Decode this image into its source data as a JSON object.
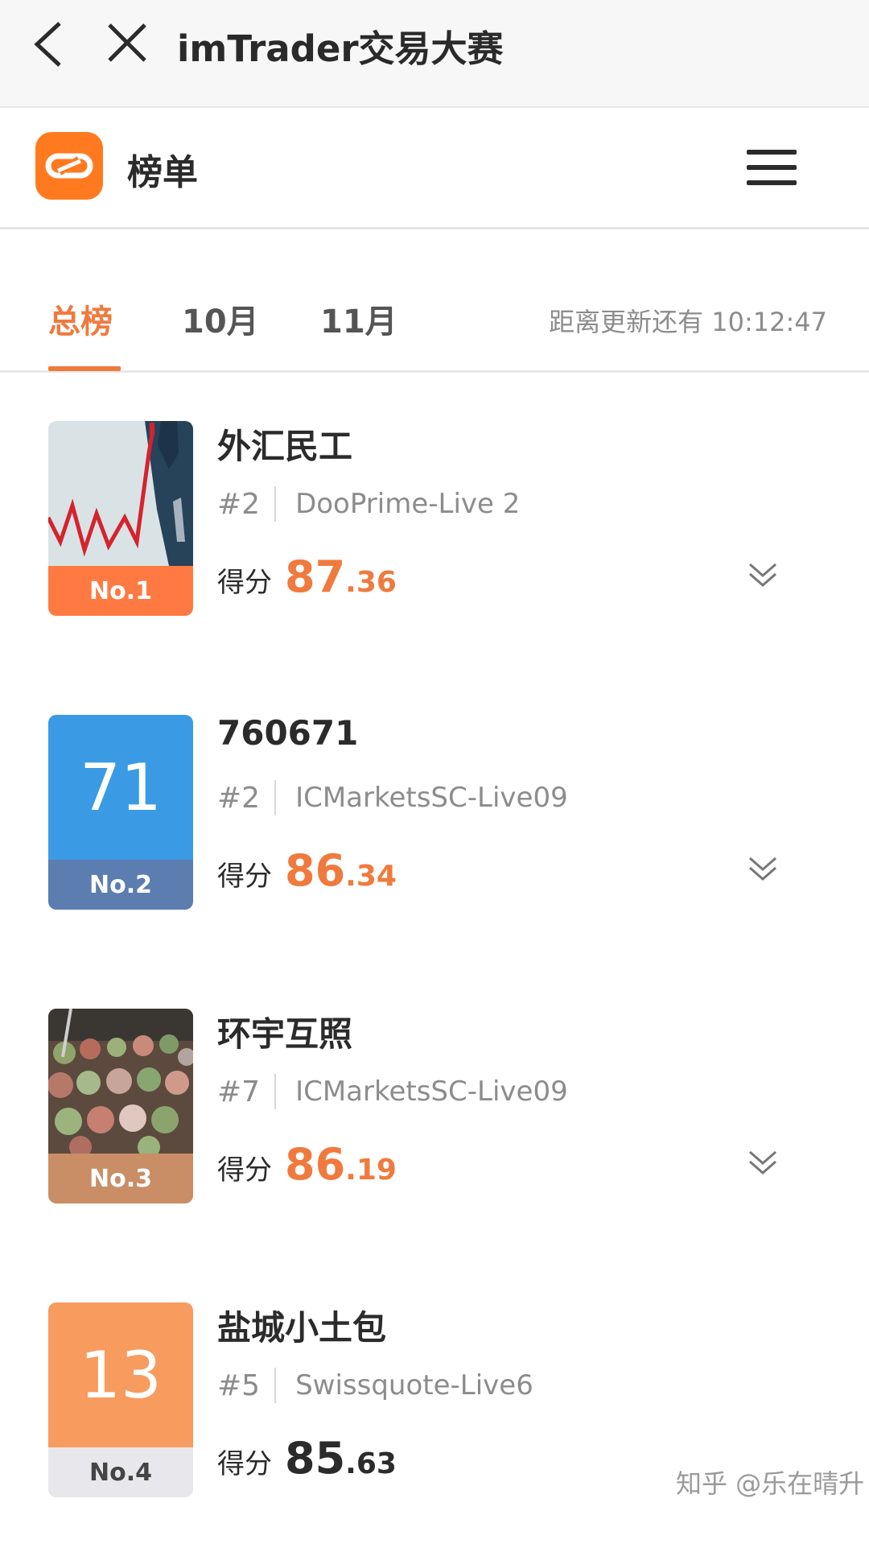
{
  "topbar": {
    "title": "imTrader交易大赛"
  },
  "header": {
    "page_title": "榜单"
  },
  "tabs": {
    "items": [
      {
        "label": "总榜",
        "active": true
      },
      {
        "label": "10月",
        "active": false
      },
      {
        "label": "11月",
        "active": false
      }
    ],
    "countdown": "距离更新还有 10:12:47"
  },
  "score_label": "得分",
  "entries": [
    {
      "name": "外汇民工",
      "position": "#2",
      "server": "DooPrime-Live 2",
      "score_int": "87",
      "score_dec": ".36",
      "rank_label": "No.1",
      "avatar_text": "",
      "avatar_color": "#d9e3e6",
      "rank_color": "#ff7a42"
    },
    {
      "name": "760671",
      "position": "#2",
      "server": "ICMarketsSC-Live09",
      "score_int": "86",
      "score_dec": ".34",
      "rank_label": "No.2",
      "avatar_text": "71",
      "avatar_color": "#3a9be4",
      "rank_color": "#5b7db0"
    },
    {
      "name": "环宇互照",
      "position": "#7",
      "server": "ICMarketsSC-Live09",
      "score_int": "86",
      "score_dec": ".19",
      "rank_label": "No.3",
      "avatar_text": "",
      "avatar_color": "#7a6a5c",
      "rank_color": "#c98e66"
    },
    {
      "name": "盐城小土包",
      "position": "#5",
      "server": "Swissquote-Live6",
      "score_int": "85",
      "score_dec": ".63",
      "rank_label": "No.4",
      "avatar_text": "13",
      "avatar_color": "#f79b5e",
      "rank_color": "#e8e8ec"
    }
  ],
  "watermark": "知乎 @乐在晴升"
}
